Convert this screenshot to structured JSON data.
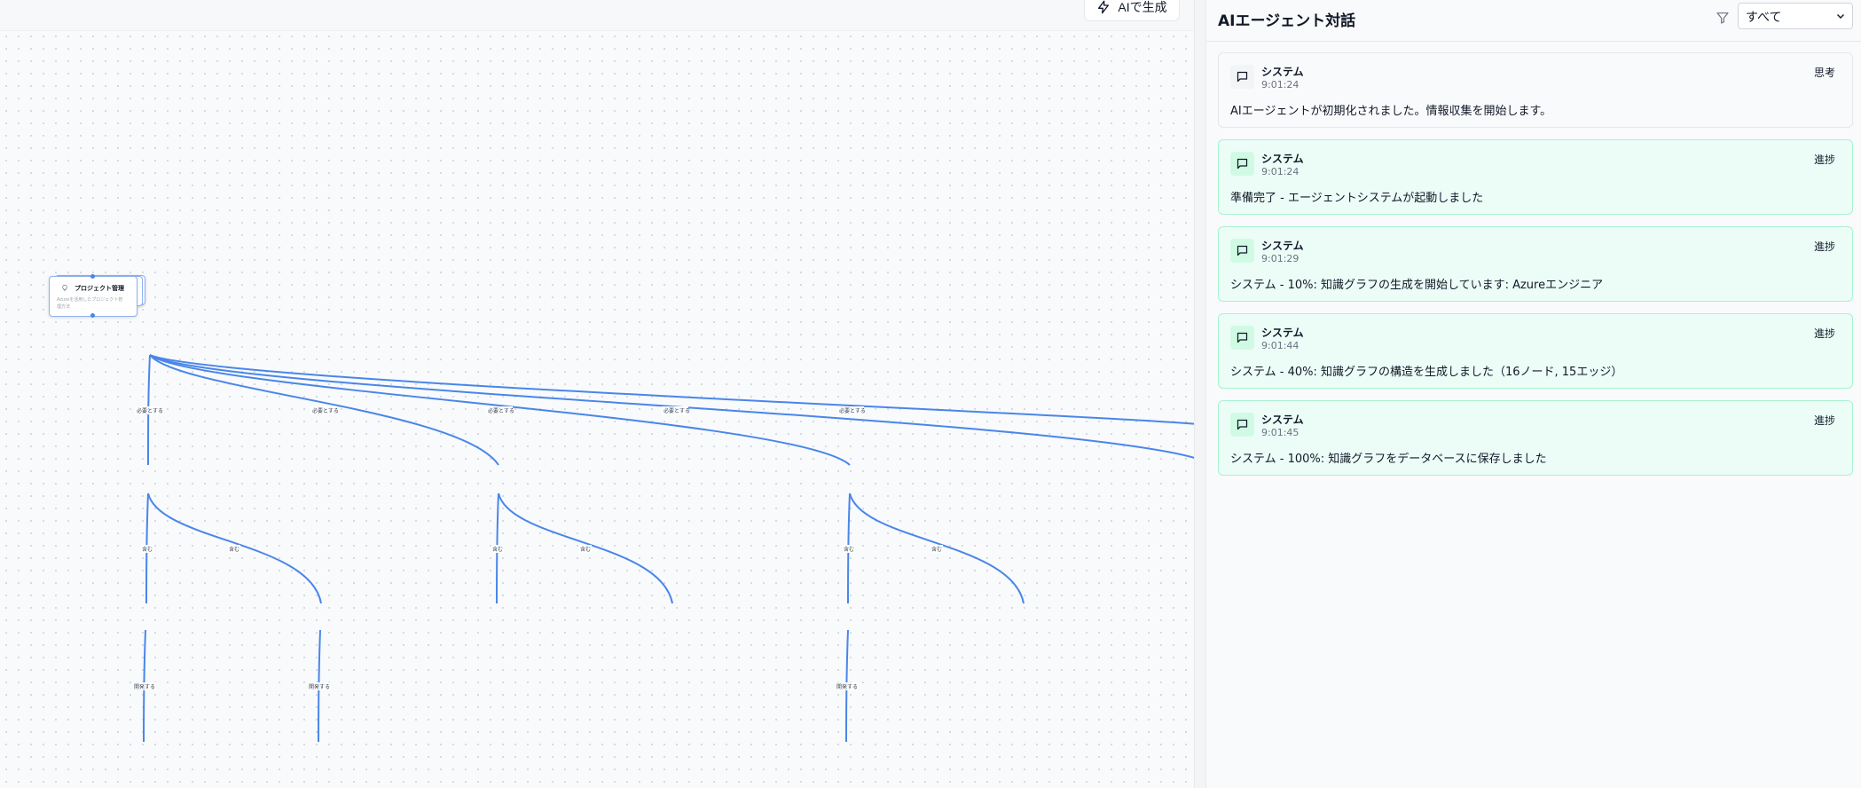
{
  "toolbar": {
    "ai_generate_label": "AIで生成",
    "ai_generate_icon": "lightning-icon"
  },
  "graph": {
    "root_node": {
      "title": "プロジェクト管理",
      "description": "Azureを活用したプロジェクト管理方法",
      "icon": "lightbulb-icon"
    },
    "edge_labels": {
      "requires": "必要とする",
      "includes": "含む",
      "develops": "開発する"
    },
    "edge_color": "#4a86e8"
  },
  "chat": {
    "title": "AIエージェント対話",
    "filter_icon": "filter-icon",
    "filter_value": "すべて",
    "messages": [
      {
        "sender": "システム",
        "time": "9:01:24",
        "type": "思考",
        "kind": "think",
        "text": "AIエージェントが初期化されました。情報収集を開始します。"
      },
      {
        "sender": "システム",
        "time": "9:01:24",
        "type": "進捗",
        "kind": "progress",
        "text": "準備完了 - エージェントシステムが起動しました"
      },
      {
        "sender": "システム",
        "time": "9:01:29",
        "type": "進捗",
        "kind": "progress",
        "text": "システム - 10%: 知識グラフの生成を開始しています: Azureエンジニア"
      },
      {
        "sender": "システム",
        "time": "9:01:44",
        "type": "進捗",
        "kind": "progress",
        "text": "システム - 40%: 知識グラフの構造を生成しました（16ノード, 15エッジ）"
      },
      {
        "sender": "システム",
        "time": "9:01:45",
        "type": "進捗",
        "kind": "progress",
        "text": "システム - 100%: 知識グラフをデータベースに保存しました"
      }
    ],
    "colors": {
      "think_bg": "#f9fafb",
      "progress_bg": "#ecfdf7",
      "progress_border": "#a7f3d0"
    }
  }
}
